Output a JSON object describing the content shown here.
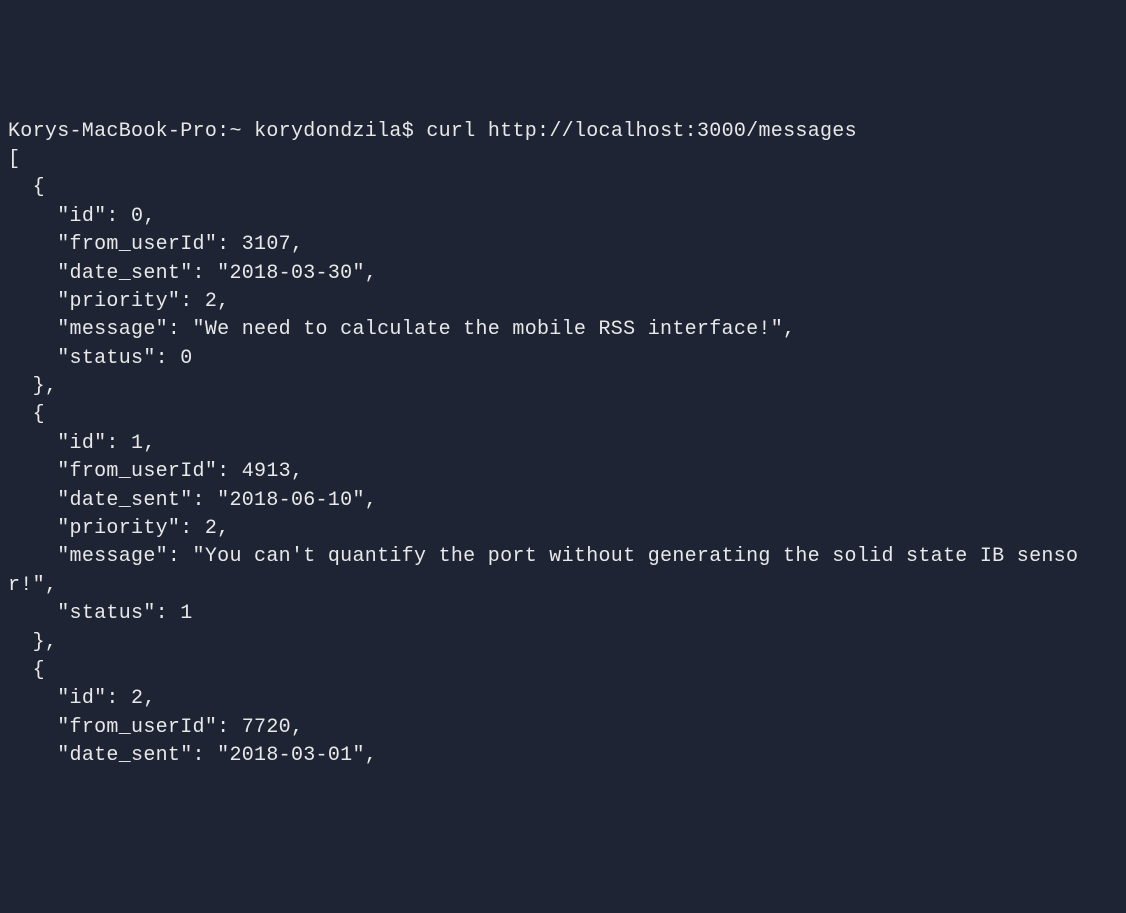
{
  "prompt": {
    "hostname": "Korys-MacBook-Pro",
    "cwd_symbol": "~",
    "username": "korydondzila",
    "prompt_char": "$",
    "command": "curl http://localhost:3000/messages"
  },
  "output_lines": [
    "[",
    "  {",
    "    \"id\": 0,",
    "    \"from_userId\": 3107,",
    "    \"date_sent\": \"2018-03-30\",",
    "    \"priority\": 2,",
    "    \"message\": \"We need to calculate the mobile RSS interface!\",",
    "    \"status\": 0",
    "  },",
    "  {",
    "    \"id\": 1,",
    "    \"from_userId\": 4913,",
    "    \"date_sent\": \"2018-06-10\",",
    "    \"priority\": 2,",
    "    \"message\": \"You can't quantify the port without generating the solid state IB sensor!\",",
    "    \"status\": 1",
    "  },",
    "  {",
    "    \"id\": 2,",
    "    \"from_userId\": 7720,",
    "    \"date_sent\": \"2018-03-01\","
  ]
}
